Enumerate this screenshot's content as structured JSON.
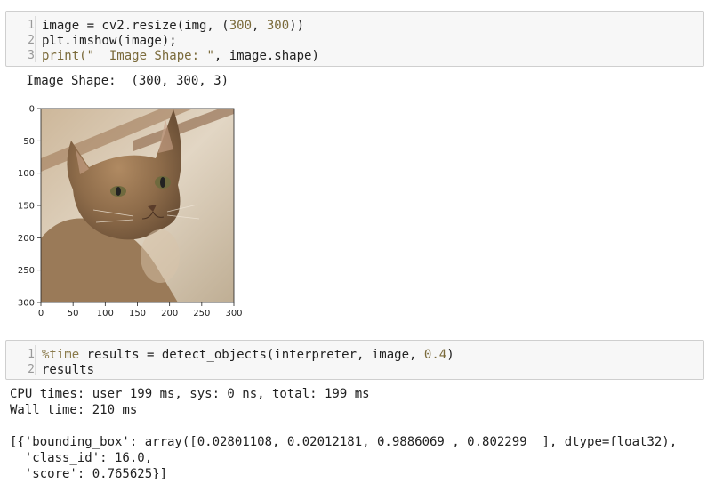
{
  "cell1": {
    "lines": [
      {
        "n": "1",
        "parts": [
          [
            "image = cv2.resize(img, (",
            ""
          ],
          [
            "300",
            "num"
          ],
          [
            ", ",
            ""
          ],
          [
            "300",
            "num"
          ],
          [
            "))",
            ""
          ]
        ]
      },
      {
        "n": "2",
        "parts": [
          [
            "plt.imshow(image);",
            ""
          ]
        ]
      },
      {
        "n": "3",
        "parts": [
          [
            "print(",
            "str"
          ],
          [
            "\"  Image Shape: \"",
            "str"
          ],
          [
            ", image.shape)",
            ""
          ]
        ]
      }
    ]
  },
  "output1": {
    "text": " Image Shape:  (300, 300, 3)"
  },
  "plot": {
    "x_ticks": [
      "0",
      "50",
      "100",
      "150",
      "200",
      "250",
      "300"
    ],
    "y_ticks": [
      "0",
      "50",
      "100",
      "150",
      "200",
      "250",
      "300"
    ],
    "image_content": "cat photo (sepia tone)",
    "x_range": [
      0,
      300
    ],
    "y_range": [
      0,
      300
    ]
  },
  "cell2": {
    "lines": [
      {
        "n": "1",
        "parts": [
          [
            "%time",
            "magic"
          ],
          [
            " results = detect_objects(interpreter, image, ",
            ""
          ],
          [
            "0.4",
            "num"
          ],
          [
            ")",
            ""
          ]
        ]
      },
      {
        "n": "2",
        "parts": [
          [
            "results",
            ""
          ]
        ]
      }
    ]
  },
  "output2": {
    "lines": [
      "CPU times: user 199 ms, sys: 0 ns, total: 199 ms",
      "Wall time: 210 ms",
      "",
      "[{'bounding_box': array([0.02801108, 0.02012181, 0.9886069 , 0.802299  ], dtype=float32),",
      "  'class_id': 16.0,",
      "  'score': 0.765625}]"
    ]
  }
}
